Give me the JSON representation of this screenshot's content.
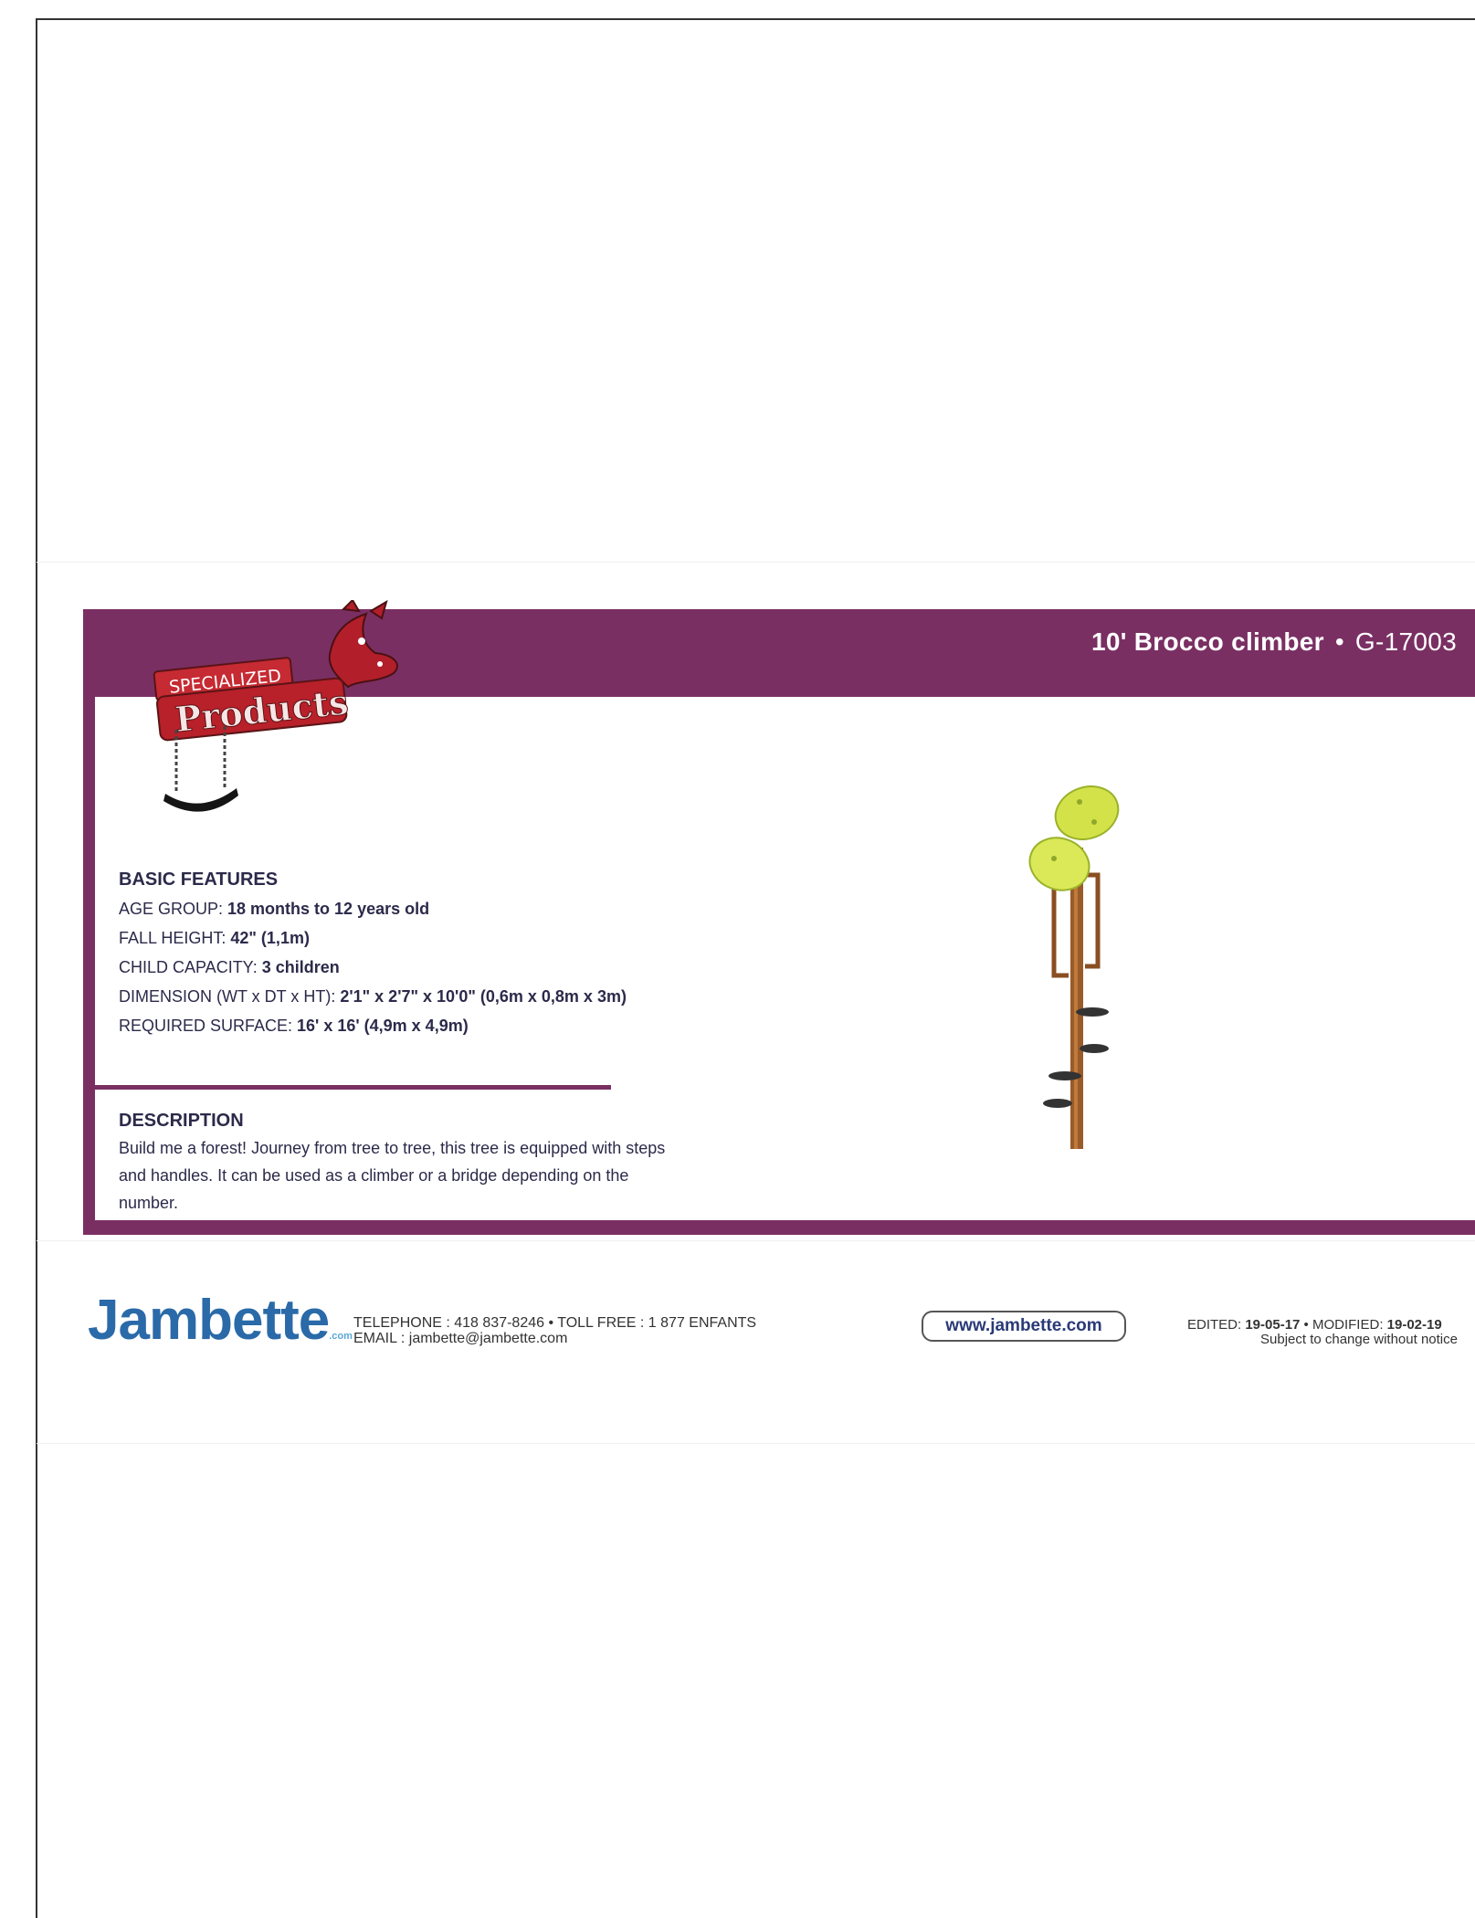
{
  "product": {
    "title_name": "10' Brocco climber",
    "title_sep": "•",
    "title_code": "G-17003"
  },
  "logo": {
    "line1": "SPECIALIZED",
    "line2": "Products"
  },
  "features": {
    "heading": "BASIC FEATURES",
    "age_label": "AGE GROUP: ",
    "age_value": "18 months to 12 years old",
    "fall_label": "FALL HEIGHT: ",
    "fall_value": "42\" (1,1m)",
    "capacity_label": "CHILD CAPACITY: ",
    "capacity_value": "3 children",
    "dimension_label": "DIMENSION (WT x DT x HT): ",
    "dimension_value": "2'1\" x 2'7\" x 10'0\" (0,6m x 0,8m x 3m)",
    "surface_label": "REQUIRED SURFACE: ",
    "surface_value": "16' x 16' (4,9m x 4,9m)"
  },
  "description": {
    "heading": "DESCRIPTION",
    "text": "Build me a forest!  Journey from tree to tree, this tree is equipped with steps and handles.  It can be used as a climber or a bridge depending on the number."
  },
  "footer": {
    "brand": "Jambette",
    "brand_suffix": ".com",
    "phone_line": "TELEPHONE : 418 837-8246  •  TOLL FREE : 1 877 ENFANTS",
    "email_line": "EMAIL : jambette@jambette.com",
    "url": "www.jambette.com",
    "edited_label": "EDITED: ",
    "edited_value": "19-05-17",
    "sep": " • ",
    "modified_label": "MODIFIED: ",
    "modified_value": "19-02-19",
    "notice": "Subject to change without notice"
  },
  "colors": {
    "accent": "#7a2f63",
    "brand_blue": "#2a6aa8",
    "text": "#2c2a4a"
  }
}
